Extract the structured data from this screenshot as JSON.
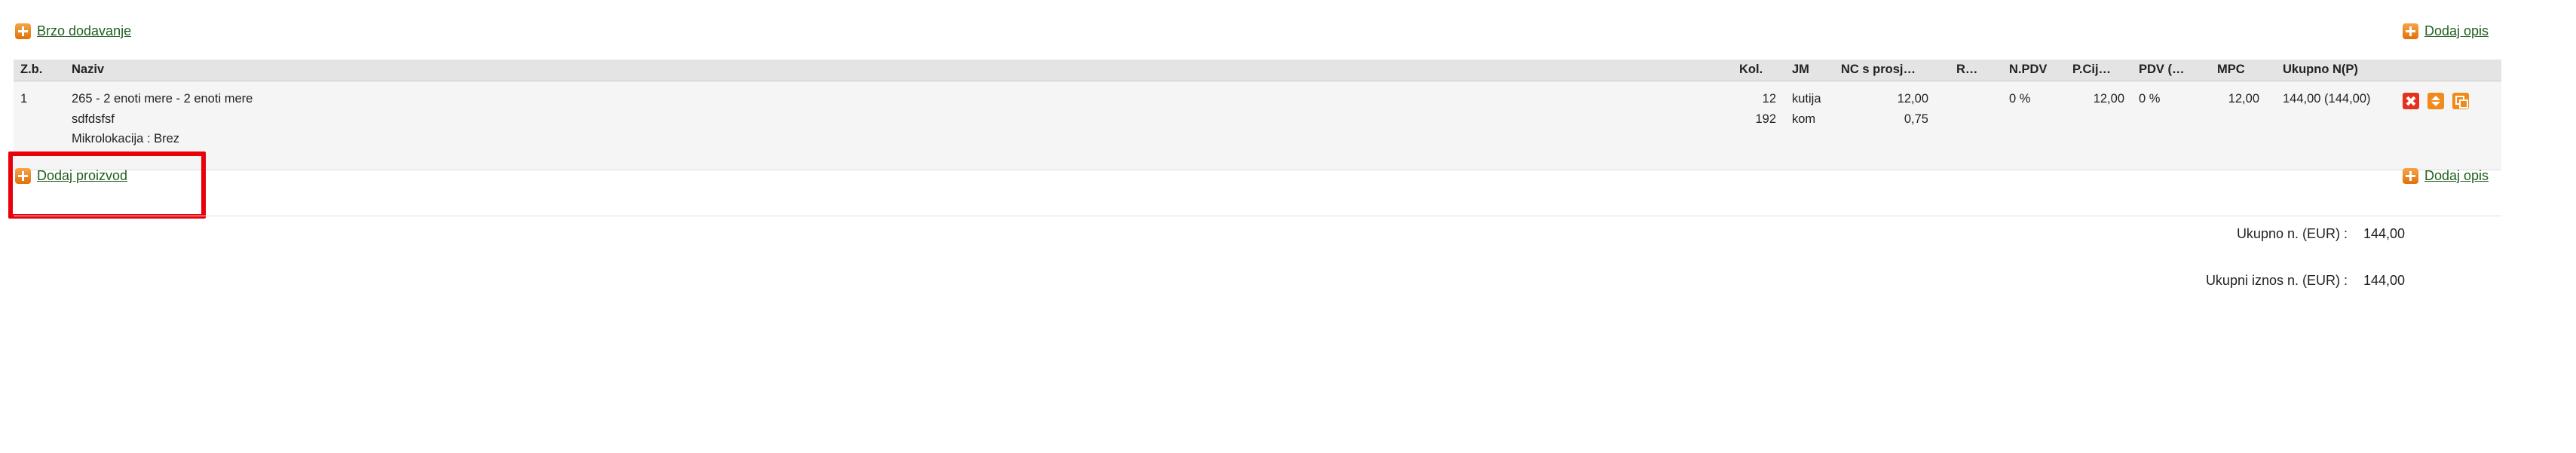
{
  "top": {
    "quick_add_label": "Brzo dodavanje",
    "add_description_label": "Dodaj opis"
  },
  "table": {
    "headers": {
      "zb": "Z.b.",
      "naziv": "Naziv",
      "kol": "Kol.",
      "jm": "JM",
      "nc": "NC s prosj…",
      "r": "R…",
      "npdv": "N.PDV",
      "pcij": "P.Cij…",
      "pdv": "PDV (…",
      "mpc": "MPC",
      "ukupno": "Ukupno N(P)"
    },
    "rows": [
      {
        "zb": "1",
        "naziv_line1": "265 - 2 enoti mere - 2 enoti mere",
        "naziv_line2": "sdfdsfsf",
        "naziv_line3": "Mikrolokacija : Brez",
        "kol_1": "12",
        "kol_2": "192",
        "jm_1": "kutija",
        "jm_2": "kom",
        "nc_1": "12,00",
        "nc_2": "0,75",
        "npdv": "0 %",
        "pcij": "12,00",
        "pdv": "0 %",
        "mpc": "12,00",
        "ukupno": "144,00 (144,00)"
      }
    ]
  },
  "bottom": {
    "add_product_label": "Dodaj proizvod",
    "add_description_label": "Dodaj opis"
  },
  "totals": {
    "ukupno_n_label": "Ukupno n. (EUR) :",
    "ukupno_n_value": "144,00",
    "ukupni_iznos_label": "Ukupni iznos n. (EUR) :",
    "ukupni_iznos_value": "144,00"
  },
  "icons": {
    "add": "add-plus-icon",
    "delete": "delete-icon",
    "update": "update-arrows-icon",
    "copy": "copy-icon"
  },
  "colors": {
    "accent_orange": "#f08a1a",
    "delete_red": "#e5321c",
    "link_green": "#1f5f1f",
    "highlight_red": "#e8000b"
  }
}
